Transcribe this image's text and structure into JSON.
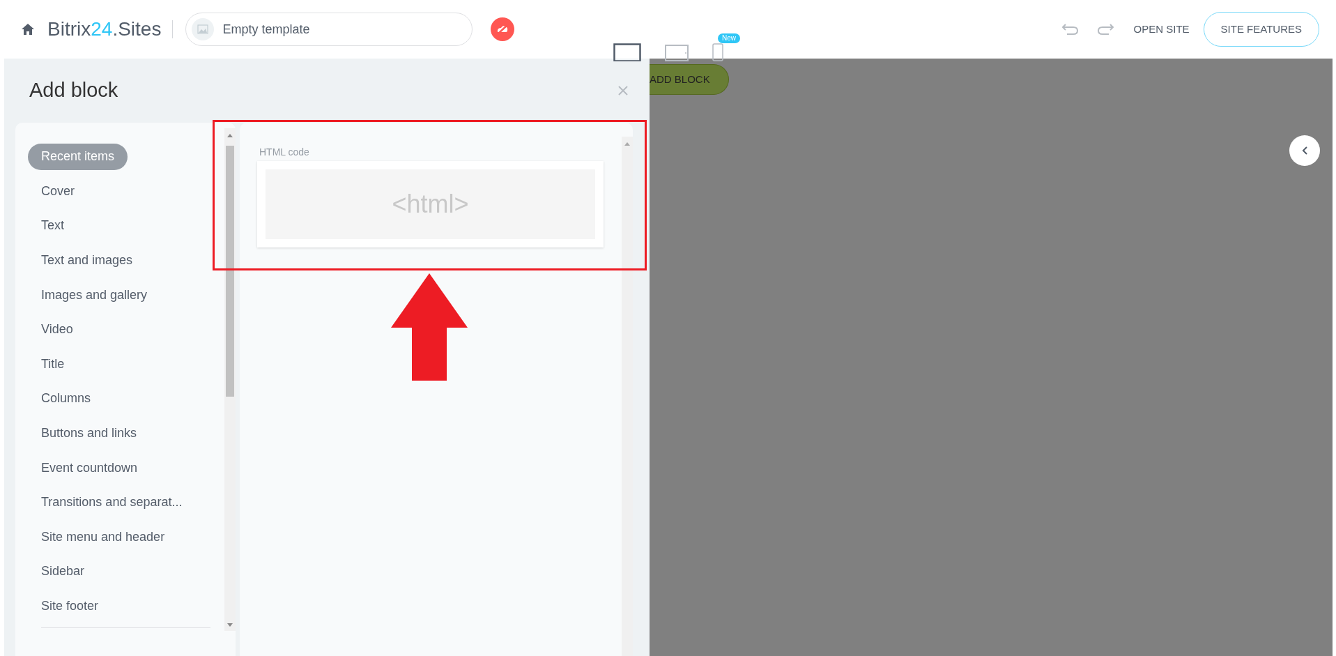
{
  "header": {
    "logo": {
      "name": "Bitrix",
      "accent": "24",
      "suffix": ".Sites"
    },
    "template_field": {
      "value": "Empty template"
    },
    "device_tabs": [
      {
        "kind": "desktop",
        "selected": true
      },
      {
        "kind": "tablet",
        "selected": false
      },
      {
        "kind": "mobile",
        "selected": false,
        "badge": "New"
      }
    ],
    "open_site": "OPEN SITE",
    "site_features": "SITE FEATURES"
  },
  "panel": {
    "title": "Add block",
    "categories": [
      {
        "label": "Recent items",
        "selected": true
      },
      {
        "label": "Cover",
        "selected": false
      },
      {
        "label": "Text",
        "selected": false
      },
      {
        "label": "Text and images",
        "selected": false
      },
      {
        "label": "Images and gallery",
        "selected": false
      },
      {
        "label": "Video",
        "selected": false
      },
      {
        "label": "Title",
        "selected": false
      },
      {
        "label": "Columns",
        "selected": false
      },
      {
        "label": "Buttons and links",
        "selected": false
      },
      {
        "label": "Event countdown",
        "selected": false
      },
      {
        "label": "Transitions and separat...",
        "selected": false
      },
      {
        "label": "Site menu and header",
        "selected": false
      },
      {
        "label": "Sidebar",
        "selected": false
      },
      {
        "label": "Site footer",
        "selected": false
      }
    ],
    "blocks": [
      {
        "label": "HTML code",
        "preview": "<html>"
      }
    ]
  },
  "canvas": {
    "add_block": "ADD BLOCK"
  }
}
